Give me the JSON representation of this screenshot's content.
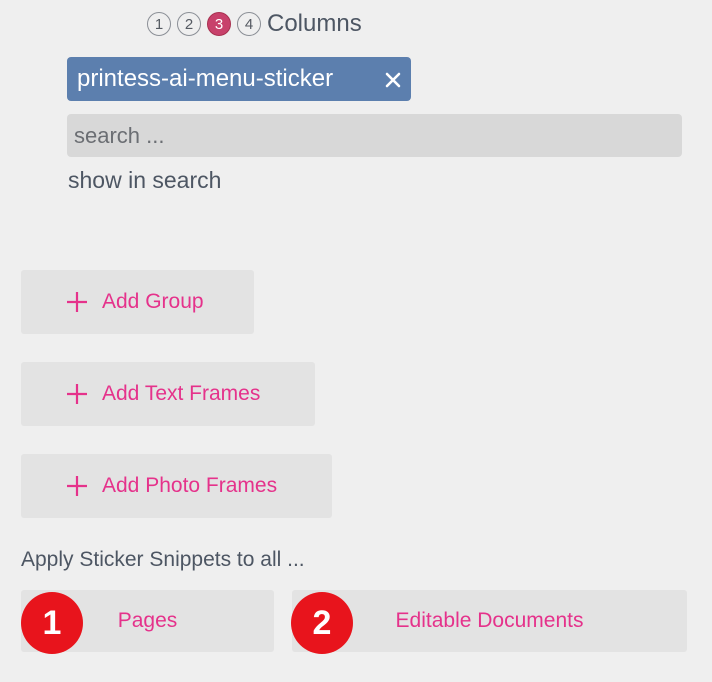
{
  "columns": {
    "options": [
      "1",
      "2",
      "3",
      "4"
    ],
    "selected": "3",
    "label": "Columns"
  },
  "tag": {
    "label": "printess-ai-menu-sticker",
    "remove_icon": "close-icon"
  },
  "search": {
    "placeholder": "search ...",
    "value": ""
  },
  "show_in_search_label": "show in search",
  "add_buttons": {
    "group": "Add Group",
    "text_frames": "Add Text Frames",
    "photo_frames": "Add Photo Frames",
    "icon": "plus-icon"
  },
  "apply": {
    "label": "Apply Sticker Snippets to all ...",
    "pages": "Pages",
    "editable_documents": "Editable Documents"
  },
  "annotations": {
    "badge_1": "1",
    "badge_2": "2"
  },
  "colors": {
    "accent": "#e5328b",
    "tag_bg": "#5c7fae",
    "selected_column": "#c8416b",
    "annotation_badge": "#e8141c"
  }
}
